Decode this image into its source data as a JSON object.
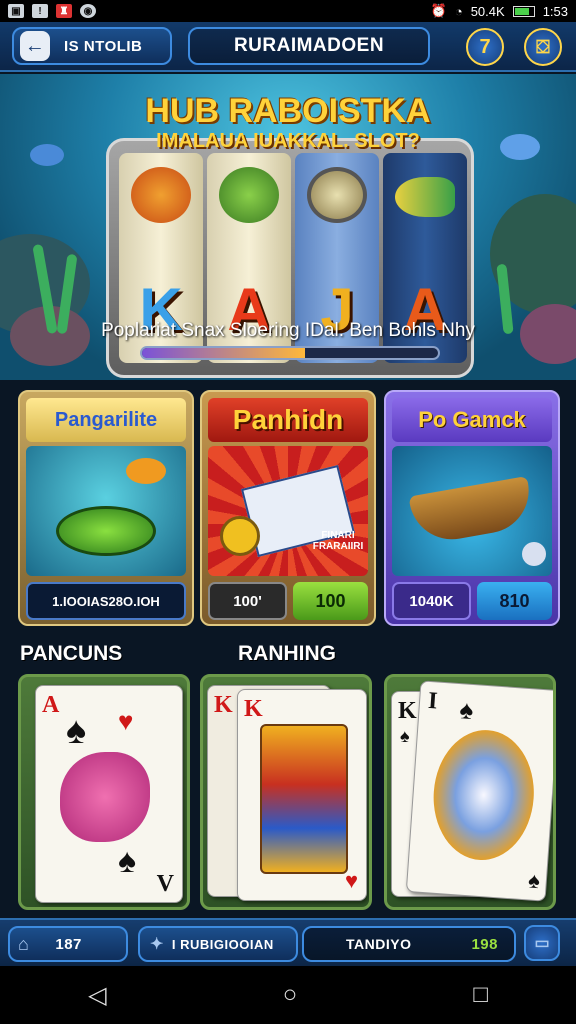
{
  "status_bar": {
    "left_icons": [
      "image-icon",
      "alert-icon",
      "game-icon",
      "spotify-icon"
    ],
    "right_text": "50.4K",
    "time": "1:53"
  },
  "top_bar": {
    "back_label": "IS NTOLIB",
    "title": "RURAIMADOEN",
    "round_button_label": "7"
  },
  "hero": {
    "title": "HUB RABOISTKA",
    "subtitle": "IMALAUA IUAKKAL. SLOT?",
    "reel_letters": [
      "K",
      "A",
      "J",
      "A"
    ],
    "banner_text": "Poplariat Snax Sloering IDal.  Ben Bohls Nhy",
    "progress_fraction": 0.55
  },
  "mode_cards": [
    {
      "title": "Pangarilite",
      "info": "1.IOOIAS28O.IOH",
      "action": ""
    },
    {
      "title": "Panhidn",
      "info": "100'",
      "action": "100",
      "art_text": "FINARI FRARAIIRI"
    },
    {
      "title": "Po Gamck",
      "info": "1040K",
      "action": "810"
    }
  ],
  "sections": {
    "left": "PANCUNS",
    "middle": "RANHING"
  },
  "decks": [
    {
      "ranks": [
        "A",
        "V"
      ]
    },
    {
      "ranks": [
        "K",
        "K"
      ]
    },
    {
      "ranks": [
        "K",
        "I"
      ]
    }
  ],
  "bottom_bar": {
    "home_value": "187",
    "middle_label": "I RUBIGIOOIAN",
    "right_label": "TANDIYO",
    "right_value": "198"
  },
  "colors": {
    "accent_gold": "#ffd23a",
    "panel_blue": "#1c4f8c",
    "card_green": "#6ad03a",
    "card_red": "#c81e1e",
    "card_purple": "#6a4ed8"
  }
}
